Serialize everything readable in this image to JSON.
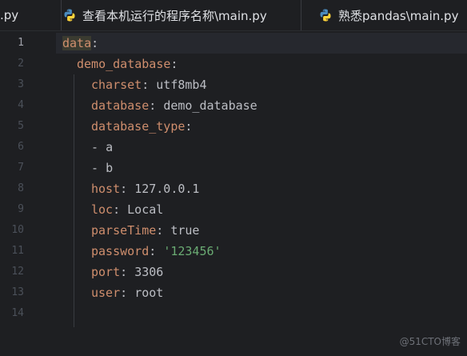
{
  "tabs": [
    {
      "label": ".py",
      "icon": "python-icon",
      "has_icon": false
    },
    {
      "label": "查看本机运行的程序名称\\main.py",
      "icon": "python-icon",
      "has_icon": true
    },
    {
      "label": "熟悉pandas\\main.py",
      "icon": "python-icon",
      "has_icon": true
    }
  ],
  "editor": {
    "lines": [
      {
        "num": "1",
        "key": "data",
        "sep": ":",
        "val": ""
      },
      {
        "num": "2",
        "key": "demo_database",
        "sep": ":",
        "val": ""
      },
      {
        "num": "3",
        "key": "charset",
        "sep": ": ",
        "val": "utf8mb4"
      },
      {
        "num": "4",
        "key": "database",
        "sep": ": ",
        "val": "demo_database"
      },
      {
        "num": "5",
        "key": "database_type",
        "sep": ":",
        "val": ""
      },
      {
        "num": "6",
        "key": "",
        "sep": "- ",
        "val": "a"
      },
      {
        "num": "7",
        "key": "",
        "sep": "- ",
        "val": "b"
      },
      {
        "num": "8",
        "key": "host",
        "sep": ": ",
        "val": "127.0.0.1"
      },
      {
        "num": "9",
        "key": "loc",
        "sep": ": ",
        "val": "Local"
      },
      {
        "num": "10",
        "key": "parseTime",
        "sep": ": ",
        "val": "true"
      },
      {
        "num": "11",
        "key": "password",
        "sep": ": ",
        "val": "'123456'"
      },
      {
        "num": "12",
        "key": "port",
        "sep": ": ",
        "val": "3306"
      },
      {
        "num": "13",
        "key": "user",
        "sep": ": ",
        "val": "root"
      },
      {
        "num": "14",
        "key": "",
        "sep": "",
        "val": ""
      }
    ]
  },
  "watermark": "@51CTO博客",
  "colors": {
    "background": "#1e1f22",
    "key": "#cf8e6d",
    "string": "#6aab73",
    "text": "#bcbec4",
    "line_number": "#4b5059"
  }
}
